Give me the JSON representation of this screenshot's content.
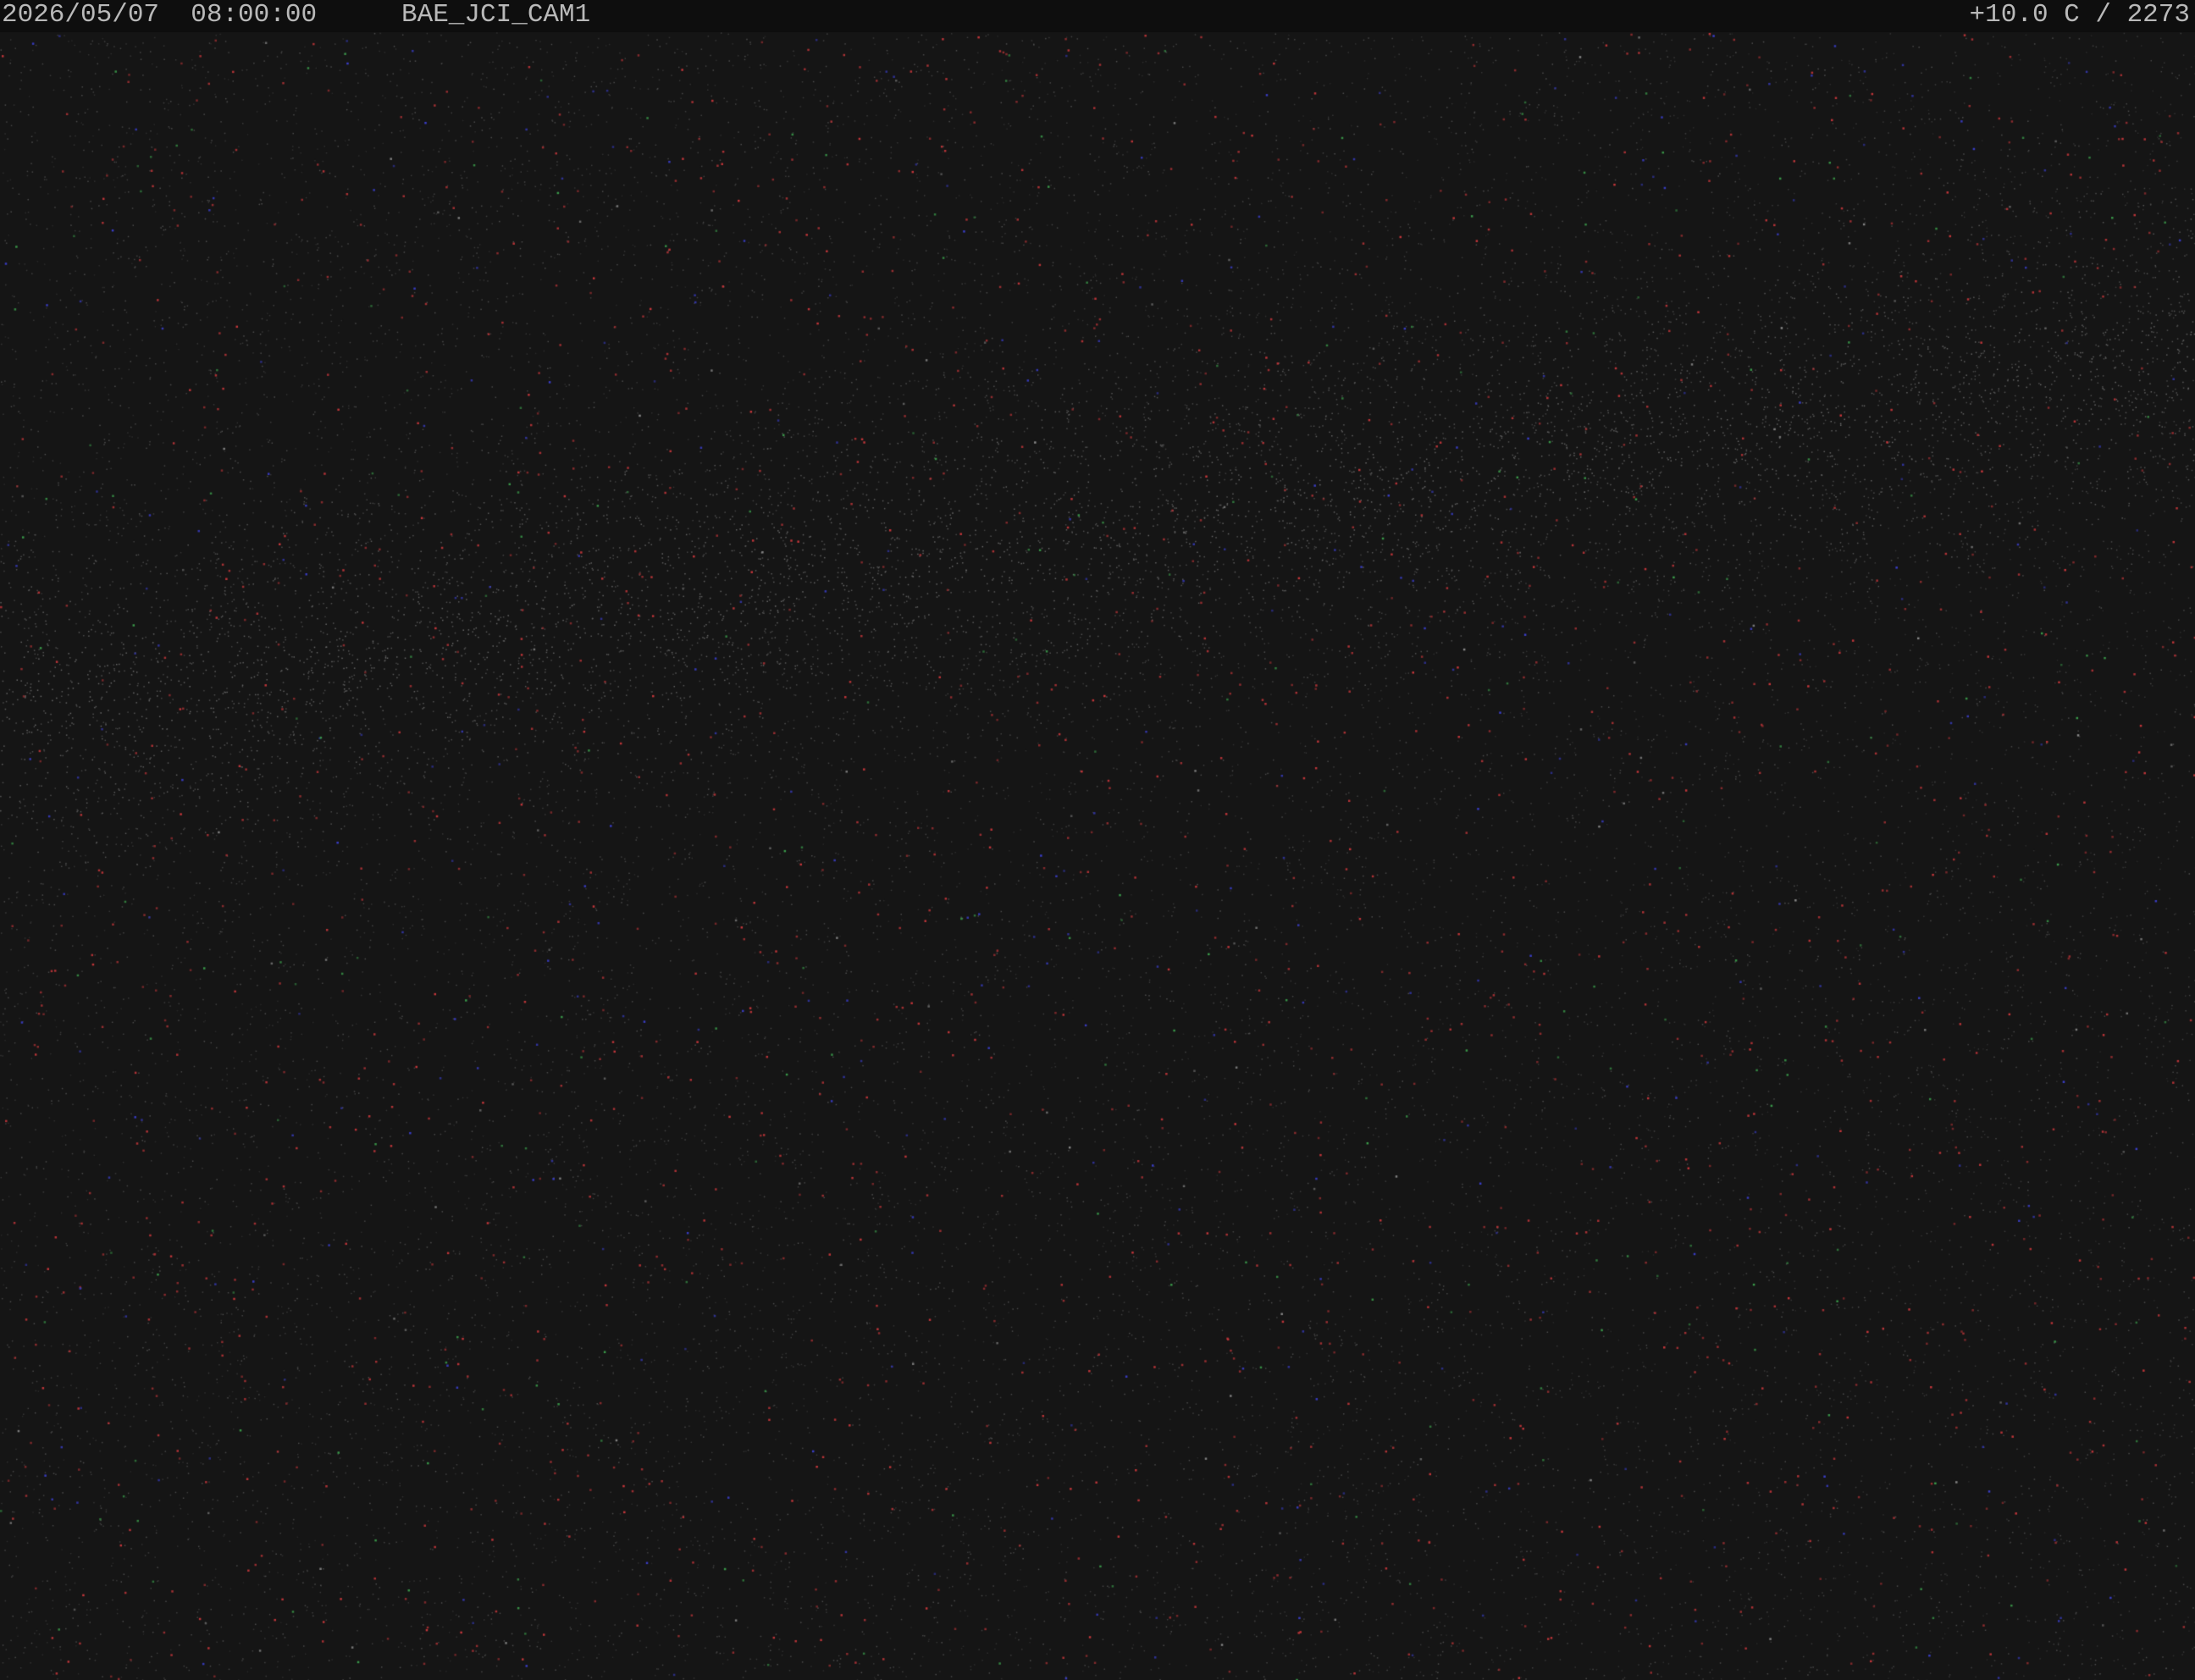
{
  "overlay": {
    "datetime": "2026/05/07  08:00:00",
    "camera_name": "BAE_JCI_CAM1",
    "readout": "+10.0 C / 2273"
  },
  "scene": {
    "content": "night-sky-star-field",
    "background_color": "#151515",
    "overlay_bar_color": "#0e0e0e",
    "overlay_text_color": "#b9b9b9",
    "hot_pixel_colors": [
      "#c2363a",
      "#3a3ec8",
      "#3a9a4a",
      "#8a8a8a"
    ]
  }
}
